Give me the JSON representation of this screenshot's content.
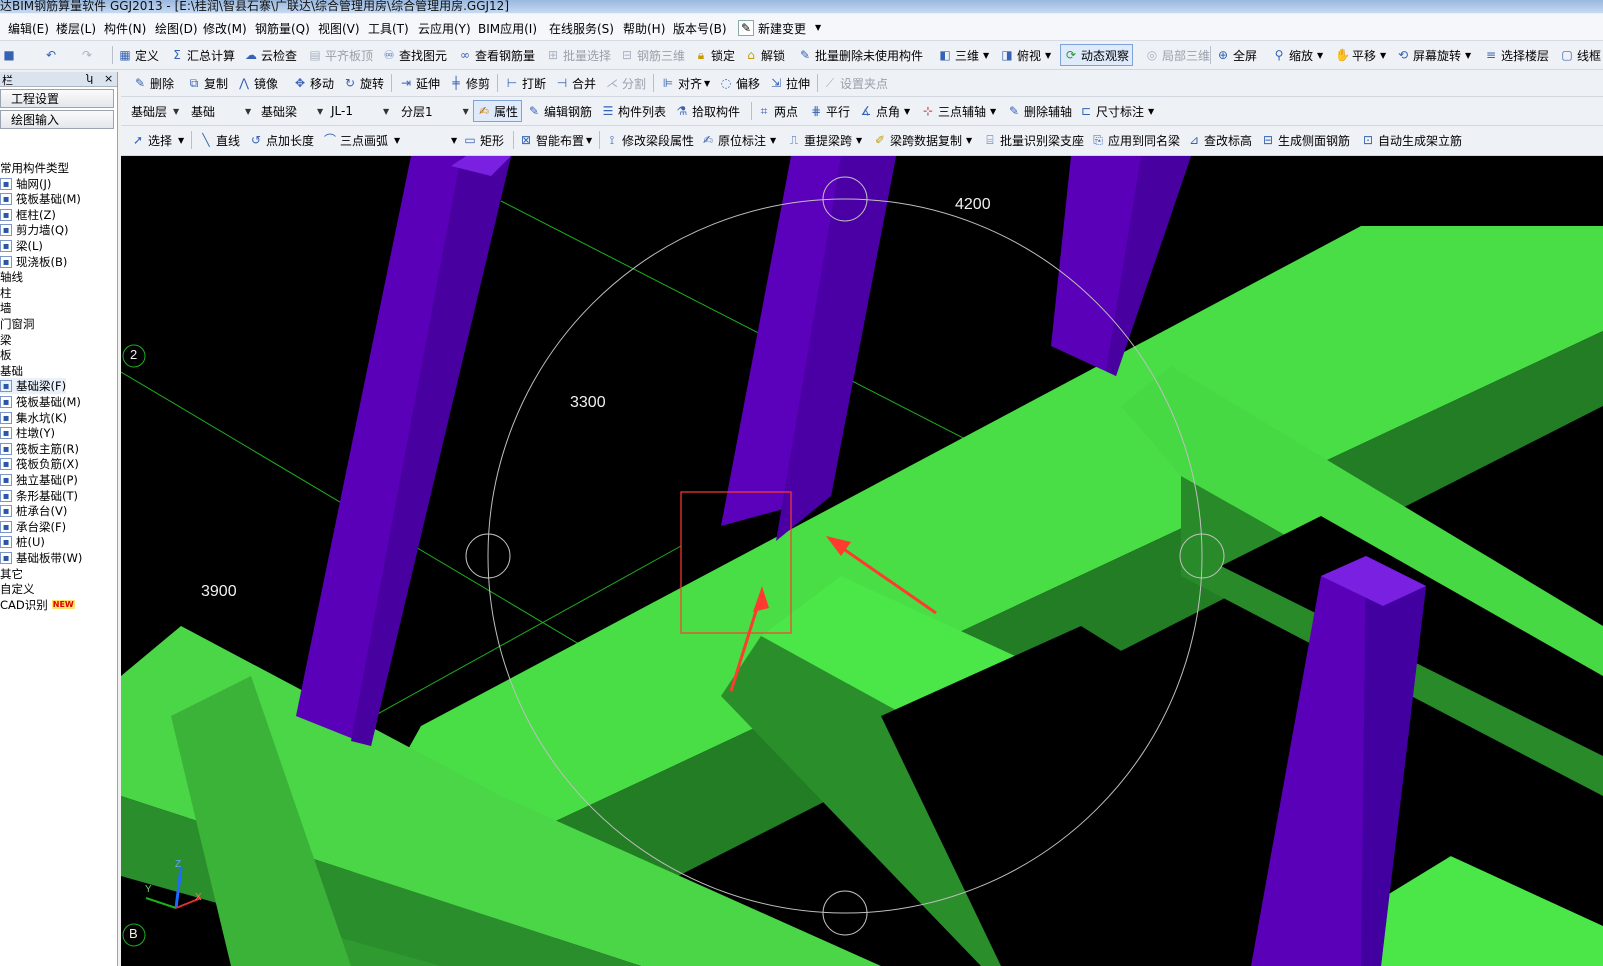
{
  "app": {
    "title": "达BIM钢筋算量软件 GGJ2013 - [E:\\桂润\\智县石寨\\广联达\\综合管理用房\\综合管理用房.GGJ12]"
  },
  "menu": [
    "编辑(E)",
    "楼层(L)",
    "构件(N)",
    "绘图(D)",
    "修改(M)",
    "钢筋量(Q)",
    "视图(V)",
    "工具(T)",
    "云应用(Y)",
    "BIM应用(I)",
    "在线服务(S)",
    "帮助(H)",
    "版本号(B)",
    "新建变更"
  ],
  "toolbar1": [
    "定义",
    "汇总计算",
    "云检查",
    "平齐板顶",
    "查找图元",
    "查看钢筋量",
    "批量选择",
    "钢筋三维",
    "锁定",
    "解锁",
    "批量删除未使用构件",
    "三维",
    "俯视",
    "动态观察",
    "局部三维",
    "全屏",
    "缩放",
    "平移",
    "屏幕旋转",
    "选择楼层",
    "线框"
  ],
  "toolbar2": [
    "删除",
    "复制",
    "镜像",
    "移动",
    "旋转",
    "延伸",
    "修剪",
    "打断",
    "合并",
    "分割",
    "对齐",
    "偏移",
    "拉伸",
    "设置夹点"
  ],
  "toolbar3": {
    "combos": [
      "基础层",
      "基础",
      "基础梁",
      "JL-1",
      "分层1"
    ],
    "buttons": [
      "属性",
      "编辑钢筋",
      "构件列表",
      "拾取构件",
      "两点",
      "平行",
      "点角",
      "三点辅轴",
      "删除辅轴",
      "尺寸标注"
    ]
  },
  "toolbar4": [
    "选择",
    "直线",
    "点加长度",
    "三点画弧",
    "矩形",
    "智能布置",
    "修改梁段属性",
    "原位标注",
    "重提梁跨",
    "梁跨数据复制",
    "批量识别梁支座",
    "应用到同名梁",
    "查改标高",
    "生成侧面钢筋",
    "自动生成架立筋"
  ],
  "panel": {
    "title": "栏",
    "pin": "ʮ",
    "close": "×",
    "nav": [
      "工程设置",
      "绘图输入"
    ],
    "tree": [
      {
        "label": "常用构件类型",
        "level": 0
      },
      {
        "label": "轴网(J)",
        "level": 1
      },
      {
        "label": "筏板基础(M)",
        "level": 1
      },
      {
        "label": "框柱(Z)",
        "level": 1
      },
      {
        "label": "剪力墙(Q)",
        "level": 1
      },
      {
        "label": "梁(L)",
        "level": 1
      },
      {
        "label": "现浇板(B)",
        "level": 1
      },
      {
        "label": "轴线",
        "level": 0
      },
      {
        "label": "柱",
        "level": 0
      },
      {
        "label": "墙",
        "level": 0
      },
      {
        "label": "门窗洞",
        "level": 0
      },
      {
        "label": "梁",
        "level": 0
      },
      {
        "label": "板",
        "level": 0
      },
      {
        "label": "基础",
        "level": 0
      },
      {
        "label": "基础梁(F)",
        "level": 1,
        "selected": true
      },
      {
        "label": "筏板基础(M)",
        "level": 1
      },
      {
        "label": "集水坑(K)",
        "level": 1
      },
      {
        "label": "柱墩(Y)",
        "level": 1
      },
      {
        "label": "筏板主筋(R)",
        "level": 1
      },
      {
        "label": "筏板负筋(X)",
        "level": 1
      },
      {
        "label": "独立基础(P)",
        "level": 1
      },
      {
        "label": "条形基础(T)",
        "level": 1
      },
      {
        "label": "桩承台(V)",
        "level": 1
      },
      {
        "label": "承台梁(F)",
        "level": 1
      },
      {
        "label": "桩(U)",
        "level": 1
      },
      {
        "label": "基础板带(W)",
        "level": 1
      },
      {
        "label": "其它",
        "level": 0
      },
      {
        "label": "自定义",
        "level": 0
      },
      {
        "label": "CAD识别",
        "level": 0,
        "badge": "NEW"
      }
    ]
  },
  "viewport": {
    "dims": [
      "4200",
      "3300",
      "3900"
    ],
    "axis_labels": [
      "2",
      "B"
    ],
    "axes": [
      "Y",
      "Z",
      "X"
    ],
    "colors": {
      "beam_top": "#4de24a",
      "beam_side": "#2f9a2f",
      "beam_dark": "#1f7a20",
      "column": "#5a00b8",
      "column_light": "#7a20e0",
      "bg": "#000000",
      "annotation": "#ff3b2f"
    }
  }
}
